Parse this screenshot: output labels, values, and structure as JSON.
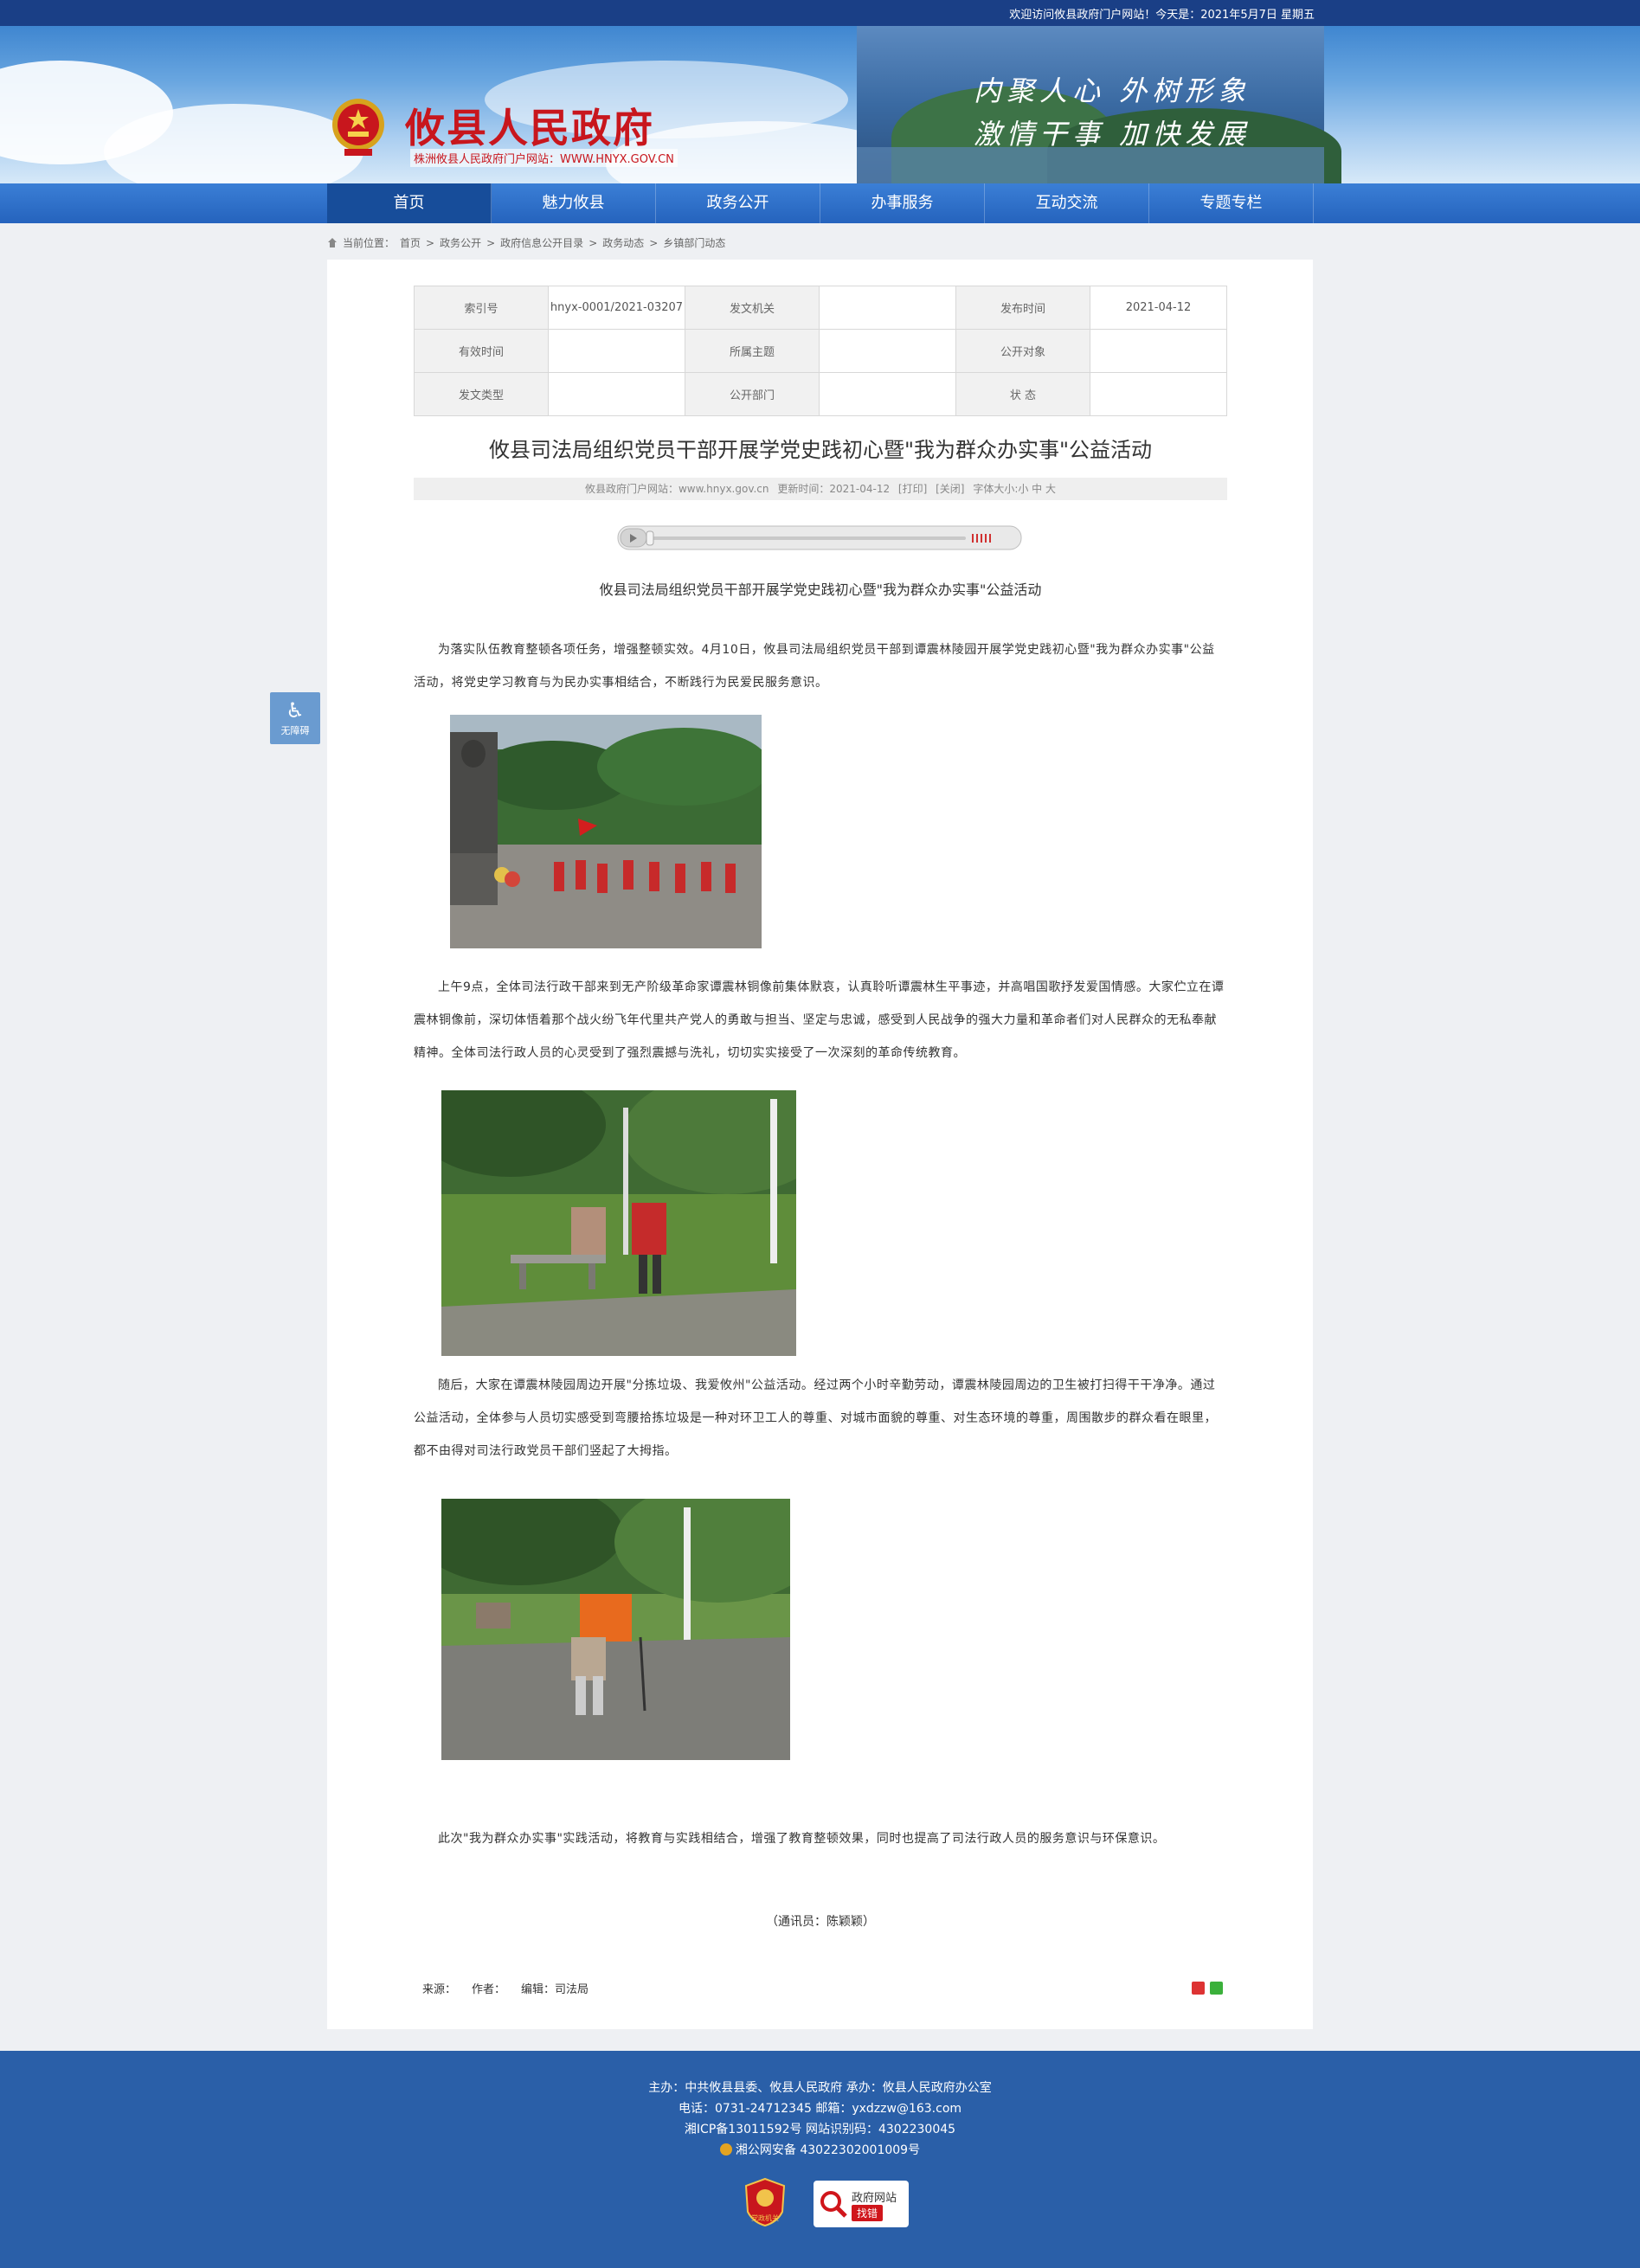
{
  "top_bar": {
    "welcome": "欢迎访问攸县政府门户网站！今天是：2021年5月7日 星期五"
  },
  "header": {
    "site_title": "攸县人民政府",
    "site_subtitle": "株洲攸县人民政府门户网站：WWW.HNYX.GOV.CN",
    "slogan_line1": "内聚人心  外树形象",
    "slogan_line2": "激情干事  加快发展"
  },
  "nav": {
    "items": [
      "首页",
      "魅力攸县",
      "政务公开",
      "办事服务",
      "互动交流",
      "专题专栏"
    ],
    "active": "首页"
  },
  "breadcrumb": {
    "prefix": "当前位置：",
    "items": [
      "首页",
      "政务公开",
      "政府信息公开目录",
      "政务动态",
      "乡镇部门动态"
    ],
    "separator": ">"
  },
  "meta_table": {
    "rows": [
      [
        {
          "k": "索引号",
          "v": "hnyx-0001/2021-03207"
        },
        {
          "k": "发文机关",
          "v": ""
        },
        {
          "k": "发布时间",
          "v": "2021-04-12"
        }
      ],
      [
        {
          "k": "有效时间",
          "v": ""
        },
        {
          "k": "所属主题",
          "v": ""
        },
        {
          "k": "公开对象",
          "v": ""
        }
      ],
      [
        {
          "k": "发文类型",
          "v": ""
        },
        {
          "k": "公开部门",
          "v": ""
        },
        {
          "k": "状 态",
          "v": ""
        }
      ]
    ]
  },
  "article": {
    "title": "攸县司法局组织党员干部开展学党史践初心暨\"我为群众办实事\"公益活动",
    "source": "攸县政府门户网站：www.hnyx.gov.cn",
    "updated": "更新时间：2021-04-12",
    "print": "[打印]",
    "close": "[关闭]",
    "font_size": "字体大小:小 中 大",
    "caption": "攸县司法局组织党员干部开展学党史践初心暨\"我为群众办实事\"公益活动",
    "paragraphs": [
      "为落实队伍教育整顿各项任务，增强整顿实效。4月10日，攸县司法局组织党员干部到谭震林陵园开展学党史践初心暨\"我为群众办实事\"公益活动，将党史学习教育与为民办实事相结合，不断践行为民爱民服务意识。",
      "上午9点，全体司法行政干部来到无产阶级革命家谭震林铜像前集体默哀，认真聆听谭震林生平事迹，并高唱国歌抒发爱国情感。大家伫立在谭震林铜像前，深切体悟着那个战火纷飞年代里共产党人的勇敢与担当、坚定与忠诚，感受到人民战争的强大力量和革命者们对人民群众的无私奉献精神。全体司法行政人员的心灵受到了强烈震撼与洗礼，切切实实接受了一次深刻的革命传统教育。",
      "随后，大家在谭震林陵园周边开展\"分拣垃圾、我爱攸州\"公益活动。经过两个小时辛勤劳动，谭震林陵园周边的卫生被打扫得干干净净。通过公益活动，全体参与人员切实感受到弯腰拾拣垃圾是一种对环卫工人的尊重、对城市面貌的尊重、对生态环境的尊重，周围散步的群众看在眼里，都不由得对司法行政党员干部们竖起了大拇指。",
      "此次\"我为群众办实事\"实践活动，将教育与实践相结合，增强了教育整顿效果，同时也提高了司法行政人员的服务意识与环保意识。"
    ],
    "reporter": "（通讯员：陈颖颖）",
    "footer_source": "来源：",
    "footer_author": "作者：",
    "footer_editor": "编辑：司法局"
  },
  "accessibility": {
    "label": "无障碍"
  },
  "footer": {
    "line1": "主办：中共攸县县委、攸县人民政府 承办：攸县人民政府办公室",
    "line2": "电话：0731-24712345 邮箱：yxdzzw@163.com",
    "line3": "湘ICP备13011592号   网站识别码：4302230045",
    "line4": "湘公网安备 43022302001009号",
    "badge1_label": "党政机关",
    "badge2_line1": "政府网站",
    "badge2_line2": "找错"
  },
  "colors": {
    "top_bar": "#1a3f86",
    "nav": "#2563bd",
    "nav_active": "#174d9a",
    "title_red": "#c8161d",
    "footer": "#2a5fa8"
  }
}
